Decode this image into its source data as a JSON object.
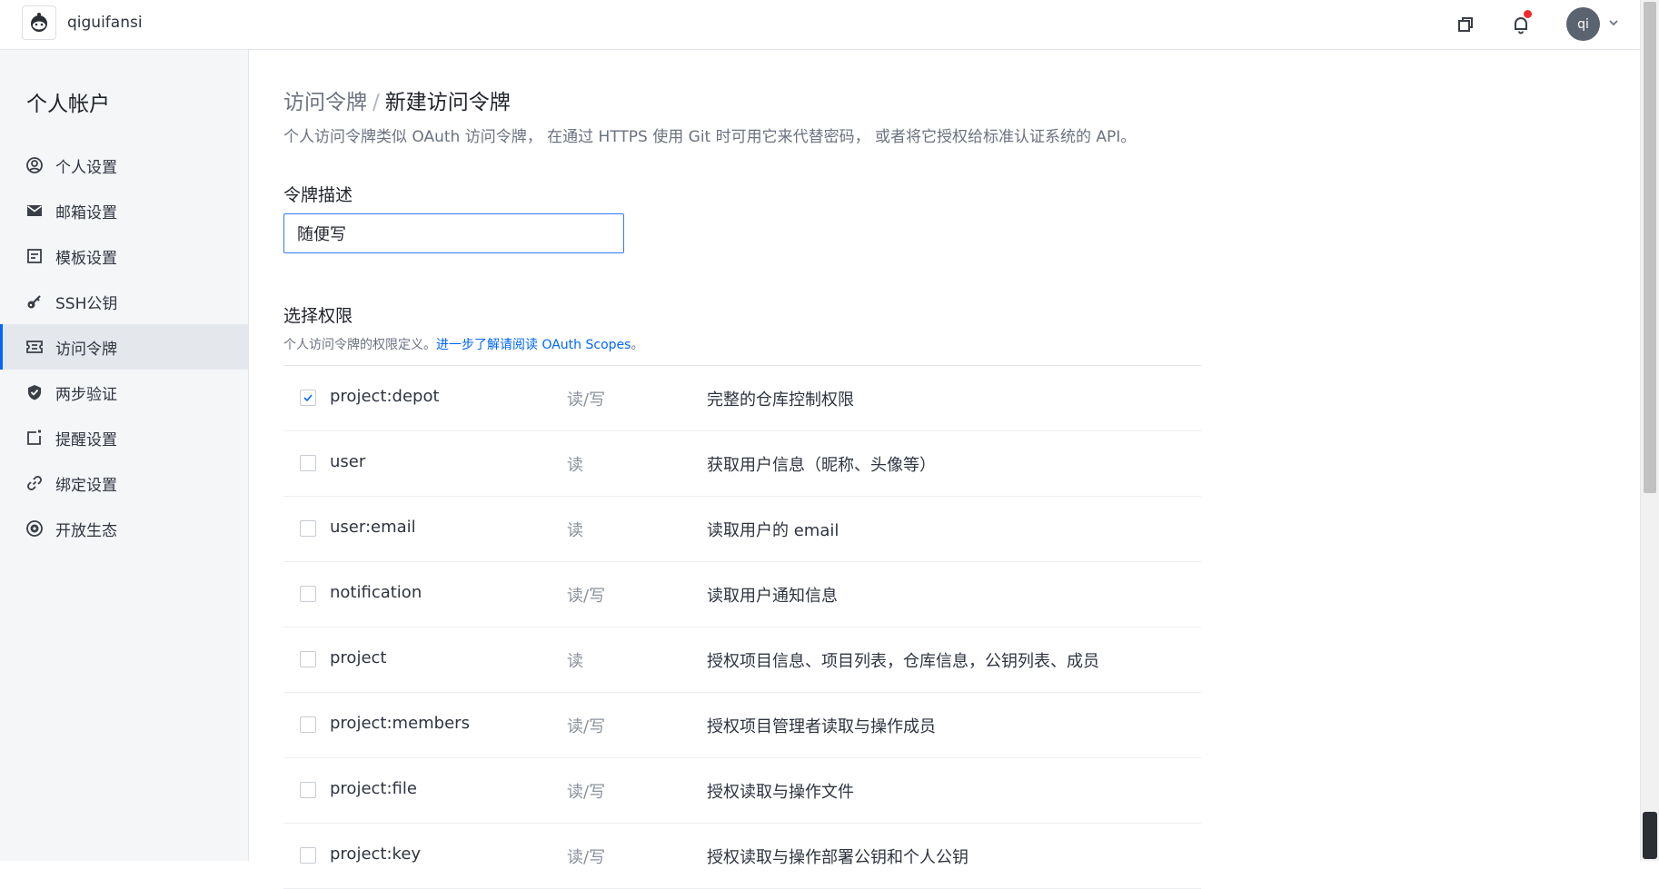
{
  "header": {
    "username": "qiguifansi",
    "avatar_text": "qi",
    "colors": {
      "notification_dot": "#f22a2a",
      "avatar_bg": "#5a6370"
    },
    "icons": [
      "logo-icon",
      "window-icon",
      "bell-icon",
      "chevron-down-icon"
    ]
  },
  "sidebar": {
    "title": "个人帐户",
    "items": [
      {
        "label": "个人设置",
        "icon": "user-circle-icon",
        "active": false
      },
      {
        "label": "邮箱设置",
        "icon": "mail-icon",
        "active": false
      },
      {
        "label": "模板设置",
        "icon": "template-icon",
        "active": false
      },
      {
        "label": "SSH公钥",
        "icon": "key-icon",
        "active": false
      },
      {
        "label": "访问令牌",
        "icon": "ticket-icon",
        "active": true
      },
      {
        "label": "两步验证",
        "icon": "shield-icon",
        "active": false
      },
      {
        "label": "提醒设置",
        "icon": "reminder-icon",
        "active": false
      },
      {
        "label": "绑定设置",
        "icon": "link-icon",
        "active": false
      },
      {
        "label": "开放生态",
        "icon": "ecosystem-icon",
        "active": false
      }
    ]
  },
  "main": {
    "breadcrumb": {
      "parent": "访问令牌",
      "separator": "/",
      "current": "新建访问令牌"
    },
    "description": "个人访问令牌类似 OAuth 访问令牌， 在通过 HTTPS 使用 Git 时可用它来代替密码， 或者将它授权给标准认证系统的 API。",
    "token_field": {
      "label": "令牌描述",
      "value": "随便写"
    },
    "permissions": {
      "title": "选择权限",
      "desc_prefix": "个人访问令牌的权限定义。",
      "link_text": "进一步了解请阅读 OAuth Scopes",
      "desc_suffix": "。",
      "rows": [
        {
          "scope": "project:depot",
          "access": "读/写",
          "description": "完整的仓库控制权限",
          "checked": true
        },
        {
          "scope": "user",
          "access": "读",
          "description": "获取用户信息（昵称、头像等）",
          "checked": false
        },
        {
          "scope": "user:email",
          "access": "读",
          "description": "读取用户的 email",
          "checked": false
        },
        {
          "scope": "notification",
          "access": "读/写",
          "description": "读取用户通知信息",
          "checked": false
        },
        {
          "scope": "project",
          "access": "读",
          "description": "授权项目信息、项目列表，仓库信息，公钥列表、成员",
          "checked": false
        },
        {
          "scope": "project:members",
          "access": "读/写",
          "description": "授权项目管理者读取与操作成员",
          "checked": false
        },
        {
          "scope": "project:file",
          "access": "读/写",
          "description": "授权读取与操作文件",
          "checked": false
        },
        {
          "scope": "project:key",
          "access": "读/写",
          "description": "授权读取与操作部署公钥和个人公钥",
          "checked": false
        }
      ]
    }
  },
  "accent_color": "#0066ff"
}
